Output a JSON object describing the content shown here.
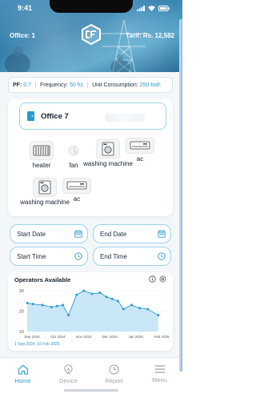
{
  "status_bar": {
    "time": "9:41"
  },
  "header": {
    "office_label": "Office: 1",
    "tarif_label": "Tarif: Rs. 12,582"
  },
  "stats": {
    "pf_key": "PF:",
    "pf_value": "0.7",
    "frequency_key": "Frequency:",
    "frequency_value": "50 hz",
    "consumption_key": "Unit Consumption:",
    "consumption_value": "250 kwh"
  },
  "office": {
    "name": "Office 7"
  },
  "devices": [
    {
      "label": "heater",
      "icon": "heater-icon"
    },
    {
      "label": "fan",
      "icon": "fan-icon"
    },
    {
      "label": "washing machine",
      "icon": "washing-machine-icon"
    },
    {
      "label": "ac",
      "icon": "ac-icon"
    },
    {
      "label": "washing machine",
      "icon": "washing-machine-icon"
    },
    {
      "label": "ac",
      "icon": "ac-icon"
    }
  ],
  "fields": {
    "start_date": "Start Date",
    "end_date": "End Date",
    "start_time": "Start Time",
    "end_time": "End Time"
  },
  "chart_title": "Operators Available",
  "chart_range": "1 Sep 2024, 10 Feb 2025",
  "chart_data": {
    "type": "area",
    "title": "Operators Available",
    "x_tick_labels": [
      "Sep 2024",
      "Oct 2024",
      "Nov 2024",
      "Dec 2024",
      "Jan 2025",
      "Feb 2025"
    ],
    "y_tick_labels": [
      "30",
      "20",
      "10"
    ],
    "ylim": [
      10,
      32
    ],
    "x": [
      "2024-09-01",
      "2024-09-08",
      "2024-09-20",
      "2024-10-01",
      "2024-10-08",
      "2024-10-15",
      "2024-10-22",
      "2024-11-01",
      "2024-11-10",
      "2024-11-20",
      "2024-11-30",
      "2024-12-08",
      "2024-12-15",
      "2024-12-22",
      "2024-12-29",
      "2025-01-08",
      "2025-01-18",
      "2025-01-28",
      "2025-02-10"
    ],
    "values": [
      24,
      23.5,
      23,
      22,
      22.5,
      23,
      18,
      28,
      30,
      28.5,
      29,
      27,
      26,
      25,
      21,
      23,
      21.5,
      21,
      18
    ],
    "color": "#2b9ad2",
    "fill_color": "#bfe3f4",
    "grid": true
  },
  "nav": {
    "home": "Home",
    "device": "Device",
    "report": "Report",
    "menu": "Menu"
  },
  "colors": {
    "accent": "#2b9ad2",
    "border": "#9ad3ea"
  }
}
